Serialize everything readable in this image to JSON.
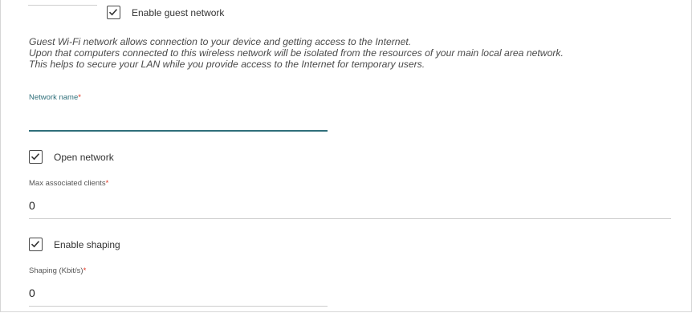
{
  "guest": {
    "enable_label": "Enable guest network",
    "enable_checked": true
  },
  "description": {
    "lines": [
      "Guest Wi-Fi network allows connection to your device and getting access to the Internet.",
      "Upon that computers connected to this wireless network will be isolated from the resources of your main local area network.",
      "This helps to secure your LAN while you provide access to the Internet for temporary users."
    ]
  },
  "network_name": {
    "label": "Network name",
    "required_mark": "*",
    "value": ""
  },
  "open_network": {
    "label": "Open network",
    "checked": true
  },
  "max_clients": {
    "label": "Max associated clients",
    "required_mark": "*",
    "value": "0"
  },
  "shaping": {
    "enable_label": "Enable shaping",
    "checked": true,
    "field_label": "Shaping (Kbit/s)",
    "required_mark": "*",
    "value": "0"
  },
  "colors": {
    "accent": "#2f6f7a",
    "required": "#e0311e",
    "checkbox_border": "#4a4a4a"
  }
}
